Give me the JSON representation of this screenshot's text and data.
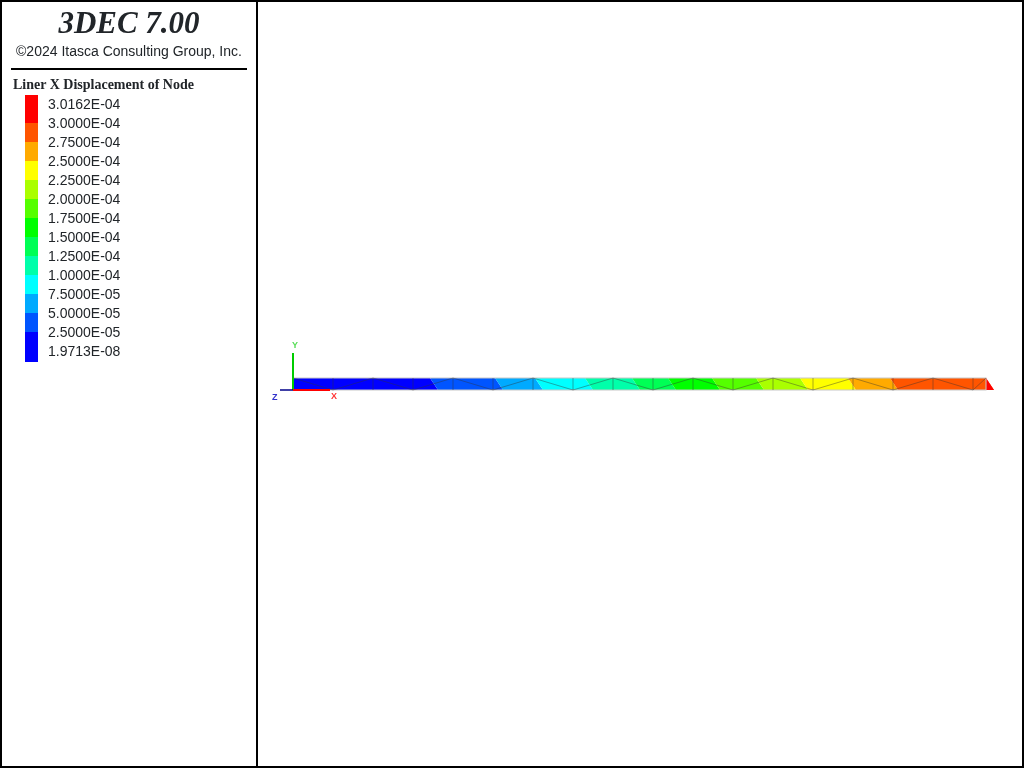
{
  "title": "3DEC 7.00",
  "copyright": "©2024 Itasca Consulting Group, Inc.",
  "legend": {
    "title": "Liner X Displacement of Node",
    "bands": [
      {
        "color": "#ff0000"
      },
      {
        "color": "#ff5500"
      },
      {
        "color": "#ffaa00"
      },
      {
        "color": "#ffff00"
      },
      {
        "color": "#aaff00"
      },
      {
        "color": "#55ff00"
      },
      {
        "color": "#00ff00"
      },
      {
        "color": "#00ff55"
      },
      {
        "color": "#00ffaa"
      },
      {
        "color": "#00ffff"
      },
      {
        "color": "#00aaff"
      },
      {
        "color": "#0055ff"
      },
      {
        "color": "#0000ff"
      }
    ],
    "labels": [
      "3.0162E-04",
      "3.0000E-04",
      "2.7500E-04",
      "2.5000E-04",
      "2.2500E-04",
      "2.0000E-04",
      "1.7500E-04",
      "1.5000E-04",
      "1.2500E-04",
      "1.0000E-04",
      "7.5000E-05",
      "5.0000E-05",
      "2.5000E-05",
      "1.9713E-08"
    ]
  },
  "axes": {
    "y": "Y",
    "z": "Z",
    "x": "X"
  }
}
